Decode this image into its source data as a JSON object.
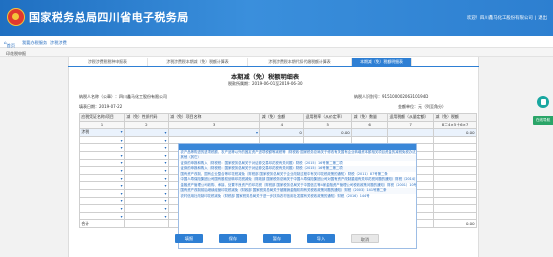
{
  "header": {
    "site_title": "国家税务总局四川省电子税务局",
    "welcome": "欢迎！四川鑫马化工股份有限公司",
    "logout": "退出"
  },
  "breadcrumb": {
    "home": "首页",
    "item1": "我要办税服务",
    "item2": "涉税涉费",
    "current_tab": "印花税申报"
  },
  "sub_tabs": [
    "涉税涉费税税种申报表",
    "涉税涉费税本期减（免）税额计算表",
    "涉税涉费税本期代扣代缴税额计算表",
    "本期减（免）税额明细表"
  ],
  "form": {
    "title": "本期减（免）税额明细表",
    "period_label": "税款所属期：",
    "period_value": "2019-06-01至2019-06-30",
    "taxpayer_name_label": "纳税人名称（公章）：",
    "taxpayer_name_value": "四川鑫马化工股份有限公司",
    "taxpayer_id_label": "纳税人识别号：",
    "taxpayer_id_value": "91510000206310194D",
    "fill_date_label": "填表日期：",
    "fill_date_value": "2019-07-22",
    "unit_label": "金额单位：元（列至角分）"
  },
  "grid": {
    "header_cells": [
      "应税凭证名称/项目",
      "减（免）性质代码",
      "减（免）项目名称",
      "减（免）金额",
      "适用税率（从价定率）",
      "减（免）数量",
      "适用税额（从量定额）",
      "减（免）税额"
    ],
    "index_cells": [
      "1",
      "2",
      "3",
      "4",
      "5",
      "6",
      "7",
      "8＝4×5＋6×7"
    ],
    "row1": {
      "name": "涉税",
      "amount": "0",
      "rate": "0.00",
      "tax": "0.00"
    },
    "row_total": {
      "label": "合计",
      "tax": "0.00"
    }
  },
  "dropdown_options": [
    "",
    "农产品等购进的进项税额、农产品等以外的固定资产进项税额等减税等（财税政·国家税务总局关于修改有关国有企业转增资本额相关项目资金的减税免税办法）财税（2008）168号",
    "其他（其它）",
    "证券的申报和购入（财税税：国家税务总局关于对证券交易印花税有关问题）财税（2015）16号第二第二项",
    "证券的申报和购入（财税税：国家税务总局关于对证券交易印花税有关问题）财税（2015）16号第二第二项",
    "国有资产改制、国有企业整合等印花税减免（财税部 国家税务总局关于企业改制过程中有关印花税政策的通知）财税（2011）87号第二条",
    "中国人寿保险集团公司国有股权划转印花税减免（财政部 国家税务总局关于中国人寿保险集团公司对国有资产改制重组有关印花税问题的通知）财税（2014）5号第二条",
    "金融资产管理公司收购、承接、处置不良资产的印花税（财税部 国家税务总局关于中国信达等4家金融资产管理公司税收政策问题的通知）财税（2001）10号",
    "国有资产改制前后继续经营印花税减免（财政部 国家税务总局关于被撤销金融机构有关税收政策问题的通知）财税（2003）141号第二条",
    "农村信用社改制印花税减免（财税部 国家税务总局关于进一步扶持农村信用社发展有关税收政策的通知）财税（2016）144号"
  ],
  "buttons": {
    "save": "保存",
    "fill": "填报",
    "temp_save": "暂存",
    "import": "导入",
    "cancel": "取消"
  },
  "side": {
    "online_service": "在线导航"
  },
  "colors": {
    "brand_blue": "#2e7fd4",
    "header_gradient": "#1f6fc1",
    "emblem_red": "#e0382f",
    "side_green": "#2aa568"
  }
}
